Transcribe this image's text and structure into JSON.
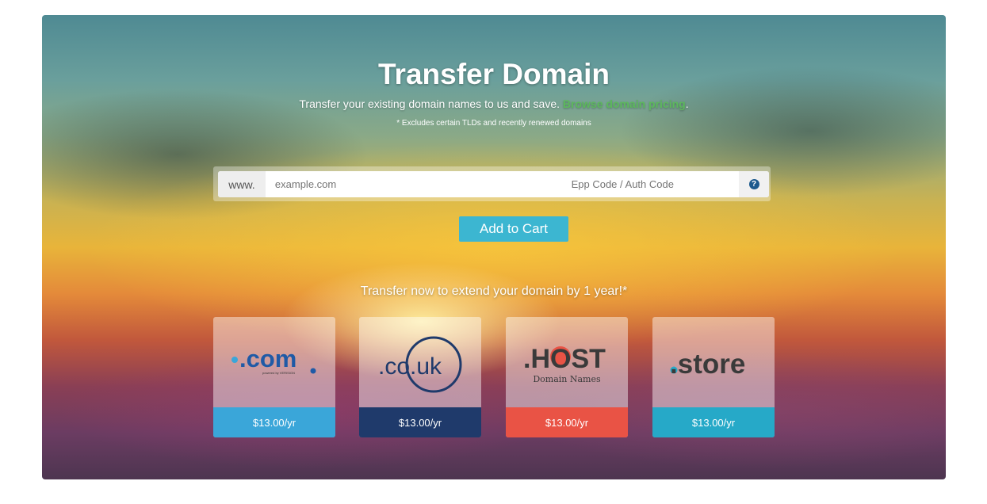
{
  "header": {
    "title": "Transfer Domain",
    "subtitle": "Transfer your existing domain names to us and save.",
    "link": "Browse domain pricing",
    "link_suffix": ".",
    "footnote": "* Excludes certain TLDs and recently renewed domains"
  },
  "form": {
    "prefix": "www.",
    "domain_placeholder": "example.com",
    "epp_placeholder": "Epp Code / Auth Code",
    "help": "?",
    "add_to_cart": "Add to Cart"
  },
  "promo": "Transfer now to extend your domain by 1 year!*",
  "tlds": [
    {
      "name": ".com",
      "sub": "powered by VERISIGN",
      "price": "$13.00/yr",
      "color": "#3aa6d9"
    },
    {
      "name": ".co.uk",
      "price": "$13.00/yr",
      "color": "#1f3a6b"
    },
    {
      "name": ".HOST",
      "sub": "Domain Names",
      "price": "$13.00/yr",
      "color": "#e95345"
    },
    {
      "name": ".store",
      "price": "$13.00/yr",
      "color": "#26a9c8"
    }
  ]
}
